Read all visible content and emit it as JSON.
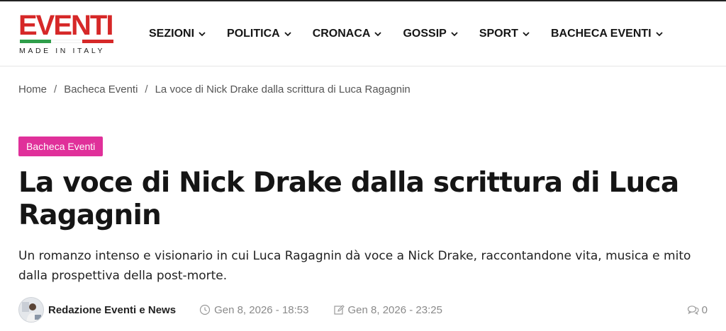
{
  "site": {
    "logo_word": "EVENTI",
    "logo_tagline": "MADE IN ITALY",
    "flag_colors": [
      "#2e9e4a",
      "#ffffff",
      "#d62828"
    ],
    "accent": "#d62828"
  },
  "nav": {
    "items": [
      {
        "label": "SEZIONI"
      },
      {
        "label": "POLITICA"
      },
      {
        "label": "CRONACA"
      },
      {
        "label": "GOSSIP"
      },
      {
        "label": "SPORT"
      },
      {
        "label": "BACHECA EVENTI"
      }
    ]
  },
  "breadcrumb": {
    "home": "Home",
    "section": "Bacheca Eventi",
    "current": "La voce di Nick Drake dalla scrittura di Luca Ragagnin",
    "separator": "/"
  },
  "article": {
    "category": "Bacheca Eventi",
    "category_color": "#e0309a",
    "title": "La voce di Nick Drake dalla scrittura di Luca Ragagnin",
    "subtitle": "Un romanzo intenso e visionario in cui Luca Ragagnin dà voce a Nick Drake, raccontandone vita, musica e mito dalla prospettiva della post-morte.",
    "author": "Redazione Eventi e News",
    "published": "Gen 8, 2026 - 18:53",
    "updated": "Gen 8, 2026 - 23:25",
    "comments": "0"
  },
  "icons": {
    "chevron": "chevron-down-icon",
    "clock": "clock-icon",
    "edit": "edit-icon",
    "comment": "comment-icon"
  }
}
